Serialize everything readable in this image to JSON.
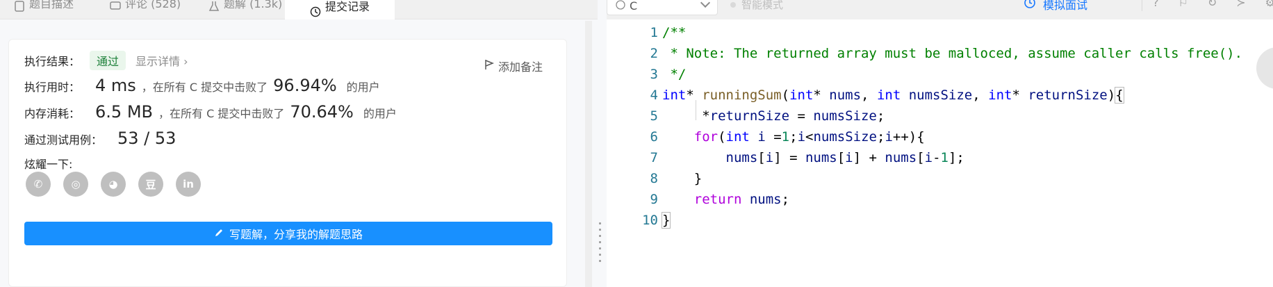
{
  "tabs": [
    {
      "label": "题目描述",
      "icon": "document-icon"
    },
    {
      "label": "评论 (528)",
      "icon": "comment-icon"
    },
    {
      "label": "题解 (1.3k)",
      "icon": "flask-icon"
    },
    {
      "label": "提交记录",
      "icon": "clock-icon",
      "active": true
    }
  ],
  "result": {
    "label": "执行结果：",
    "status": "通过",
    "details": "显示详情 ›",
    "add_note": "添加备注"
  },
  "runtime": {
    "label": "执行用时：",
    "value": "4 ms",
    "mid": "，在所有 C 提交中击败了",
    "pct": "96.94%",
    "tail": "的用户"
  },
  "memory": {
    "label": "内存消耗：",
    "value": "6.5 MB",
    "mid": "，在所有 C 提交中击败了",
    "pct": "70.64%",
    "tail": "的用户"
  },
  "tests": {
    "label": "通过测试用例：",
    "value": "53 / 53"
  },
  "share": {
    "label": "炫耀一下:",
    "icons": [
      "wechat-icon",
      "weibo-icon",
      "qq-icon",
      "douban-icon",
      "linkedin-icon"
    ],
    "glyphs": [
      "✆",
      "◎",
      "◕",
      "豆",
      "in"
    ]
  },
  "write_button": "写题解，分享我的解题思路",
  "editor": {
    "language": "C",
    "smart_mode": "智能模式",
    "mock_interview": "模拟面试",
    "line_numbers": [
      "1",
      "2",
      "3",
      "4",
      "5",
      "6",
      "7",
      "8",
      "9",
      "10"
    ]
  },
  "colors": {
    "accent": "#1890ff",
    "pass_green": "#1a7f37",
    "comment": "#008000",
    "keyword": "#0000ff"
  }
}
